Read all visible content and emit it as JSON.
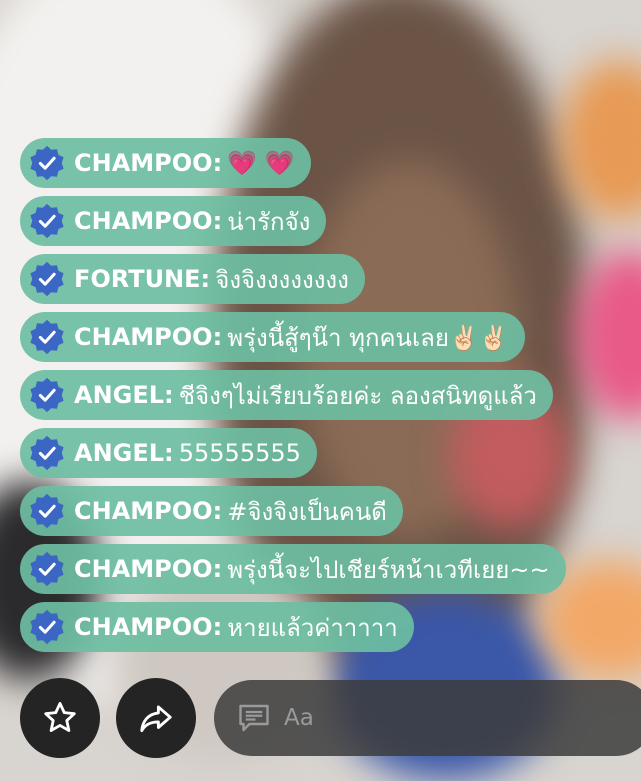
{
  "chat": [
    {
      "name": "CHAMPOO",
      "sep": ":",
      "message": "💗 💗"
    },
    {
      "name": "CHAMPOO",
      "sep": ":",
      "message": "น่ารักจัง"
    },
    {
      "name": "FORTUNE",
      "sep": ":",
      "message": "จิงจิงงงงงงงง"
    },
    {
      "name": "CHAMPOO",
      "sep": ":",
      "message": "พรุ่งนี้สู้ๆน๊า ทุกคนเลย✌🏻✌🏻"
    },
    {
      "name": "ANGEL",
      "sep": ":",
      "message": "ชีจิงๆไม่เรียบร้อยค่ะ ลองสนิทดูแล้ว"
    },
    {
      "name": "ANGEL",
      "sep": ":",
      "message": "55555555"
    },
    {
      "name": "CHAMPOO",
      "sep": ":",
      "message": "#จิงจิงเป็นคนดี"
    },
    {
      "name": "CHAMPOO",
      "sep": ":",
      "message": "พรุ่งนี้จะไปเชียร์หน้าเวทีเยย~~"
    },
    {
      "name": "CHAMPOO",
      "sep": ":",
      "message": "หายแล้วค่าาาาา"
    }
  ],
  "footer": {
    "star_icon": "star-icon",
    "share_icon": "share-icon",
    "comment_icon": "comment-icon",
    "input_placeholder": "Aa"
  },
  "colors": {
    "bubble": "#6cbea2",
    "badge": "#3b66c4",
    "button": "#242424"
  }
}
